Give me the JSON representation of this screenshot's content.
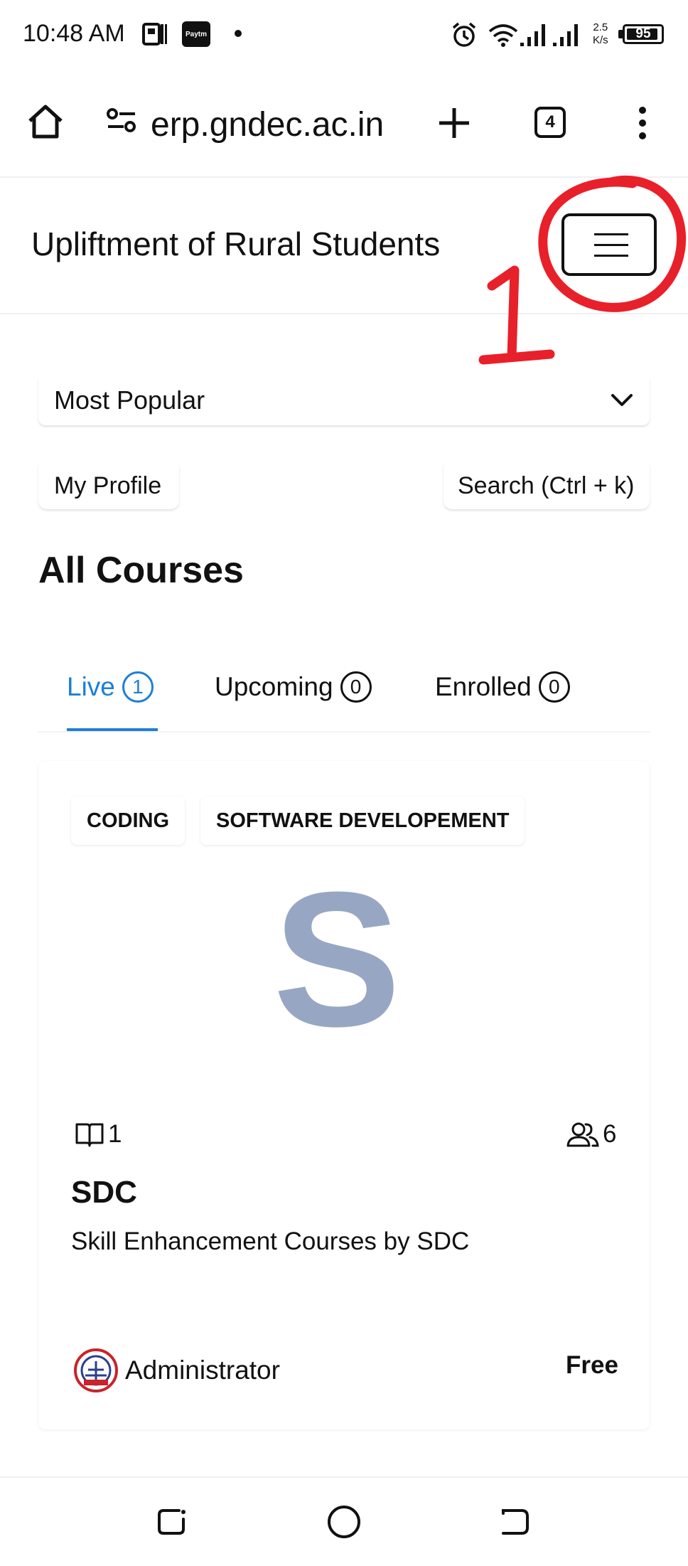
{
  "status_bar": {
    "time": "10:48 AM",
    "paytm_label": "Paytm",
    "net_speed_value": "2.5",
    "net_speed_unit": "K/s",
    "battery": "95",
    "icons": [
      "portfolio-icon",
      "paytm-icon",
      "notification-dot-icon",
      "alarm-icon",
      "wifi-icon",
      "signal-icon",
      "signal-icon",
      "battery-icon"
    ]
  },
  "browser": {
    "url": "erp.gndec.ac.in",
    "tab_count": "4",
    "icons": [
      "home-icon",
      "site-settings-icon",
      "new-tab-icon",
      "tab-switcher-icon",
      "more-vert-icon"
    ]
  },
  "header": {
    "title": "Upliftment of Rural Students",
    "menu_icon": "hamburger-menu-icon",
    "annotation_label": "1",
    "annotation_color": "#e8202a"
  },
  "filters": {
    "sort_selected": "Most Popular",
    "profile_button": "My Profile",
    "search_button": "Search (Ctrl + k)"
  },
  "section_title": "All Courses",
  "tabs": [
    {
      "label": "Live",
      "count": "1",
      "active": true
    },
    {
      "label": "Upcoming",
      "count": "0",
      "active": false
    },
    {
      "label": "Enrolled",
      "count": "0",
      "active": false
    }
  ],
  "accent_color": "#1d7fd7",
  "course": {
    "tags": [
      "CODING",
      "SOFTWARE DEVELOPEMENT"
    ],
    "placeholder_letter": "S",
    "lessons_count": "1",
    "students_count": "6",
    "title": "SDC",
    "description": "Skill Enhancement Courses by SDC",
    "author": "Administrator",
    "price": "Free"
  },
  "navbar": {
    "icons": [
      "recent-apps-icon",
      "home-circle-icon",
      "back-icon"
    ]
  }
}
